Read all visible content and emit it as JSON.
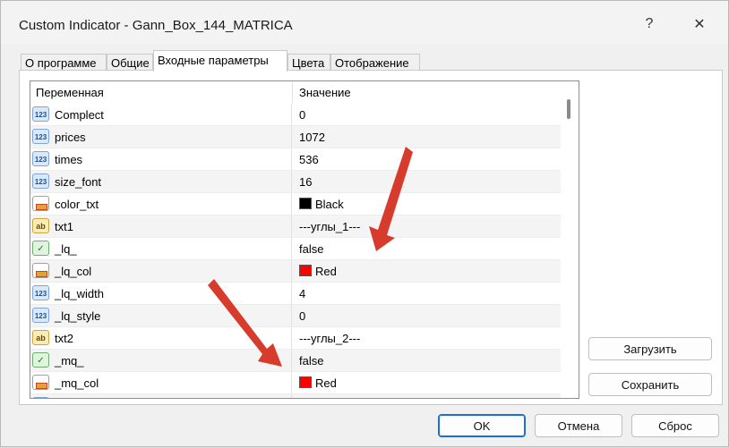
{
  "window": {
    "title": "Custom Indicator - Gann_Box_144_MATRICA",
    "help_label": "?",
    "close_label": "✕"
  },
  "tabs": [
    {
      "label": "О программе",
      "active": false
    },
    {
      "label": "Общие",
      "active": false
    },
    {
      "label": "Входные параметры",
      "active": true
    },
    {
      "label": "Цвета",
      "active": false
    },
    {
      "label": "Отображение",
      "active": false
    }
  ],
  "table": {
    "headers": {
      "variable": "Переменная",
      "value": "Значение"
    },
    "rows": [
      {
        "type": "num",
        "type_label": "123",
        "name": "Complect",
        "value": "0"
      },
      {
        "type": "num",
        "type_label": "123",
        "name": "prices",
        "value": "1072"
      },
      {
        "type": "num",
        "type_label": "123",
        "name": "times",
        "value": "536"
      },
      {
        "type": "num",
        "type_label": "123",
        "name": "size_font",
        "value": "16"
      },
      {
        "type": "color",
        "type_label": "",
        "name": "color_txt",
        "value": "Black",
        "swatch": "#000000"
      },
      {
        "type": "str",
        "type_label": "ab",
        "name": "txt1",
        "value": "---углы_1---"
      },
      {
        "type": "bool",
        "type_label": "✓",
        "name": "_lq_",
        "value": "false"
      },
      {
        "type": "color",
        "type_label": "",
        "name": "_lq_col",
        "value": "Red",
        "swatch": "#ff0000"
      },
      {
        "type": "num",
        "type_label": "123",
        "name": "_lq_width",
        "value": "4"
      },
      {
        "type": "num",
        "type_label": "123",
        "name": "_lq_style",
        "value": "0"
      },
      {
        "type": "str",
        "type_label": "ab",
        "name": "txt2",
        "value": "---углы_2---"
      },
      {
        "type": "bool",
        "type_label": "✓",
        "name": "_mq_",
        "value": "false"
      },
      {
        "type": "color",
        "type_label": "",
        "name": "_mq_col",
        "value": "Red",
        "swatch": "#ff0000"
      },
      {
        "type": "num",
        "type_label": "123",
        "name": "",
        "value": ""
      }
    ]
  },
  "side_buttons": {
    "load": "Загрузить",
    "save": "Сохранить"
  },
  "footer_buttons": {
    "ok": "OK",
    "cancel": "Отмена",
    "reset": "Сброс"
  },
  "annotation_color": "#d63b2b"
}
